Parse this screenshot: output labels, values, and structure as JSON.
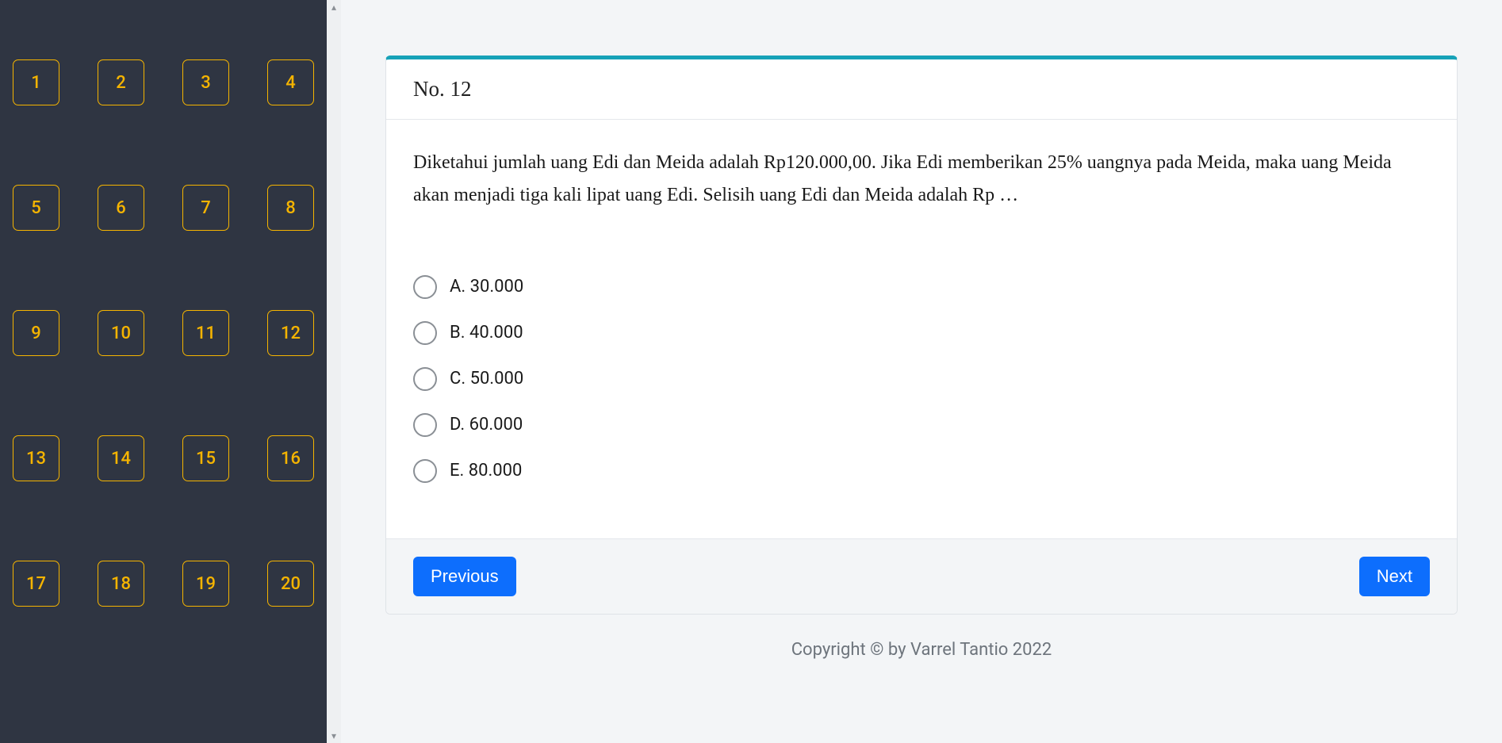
{
  "sidebar": {
    "items": [
      "1",
      "2",
      "3",
      "4",
      "5",
      "6",
      "7",
      "8",
      "9",
      "10",
      "11",
      "12",
      "13",
      "14",
      "15",
      "16",
      "17",
      "18",
      "19",
      "20"
    ]
  },
  "question": {
    "number_label": "No. 12",
    "text": "Diketahui jumlah uang Edi dan Meida adalah Rp120.000,00. Jika Edi memberikan 25% uangnya pada Meida, maka uang Meida akan menjadi tiga kali lipat uang Edi. Selisih uang Edi dan Meida adalah Rp …",
    "options": [
      {
        "label": "A. 30.000"
      },
      {
        "label": "B. 40.000"
      },
      {
        "label": "C. 50.000"
      },
      {
        "label": "D. 60.000"
      },
      {
        "label": "E. 80.000"
      }
    ]
  },
  "nav": {
    "previous": "Previous",
    "next": "Next"
  },
  "footer": {
    "copyright": "Copyright © by Varrel Tantio 2022"
  }
}
